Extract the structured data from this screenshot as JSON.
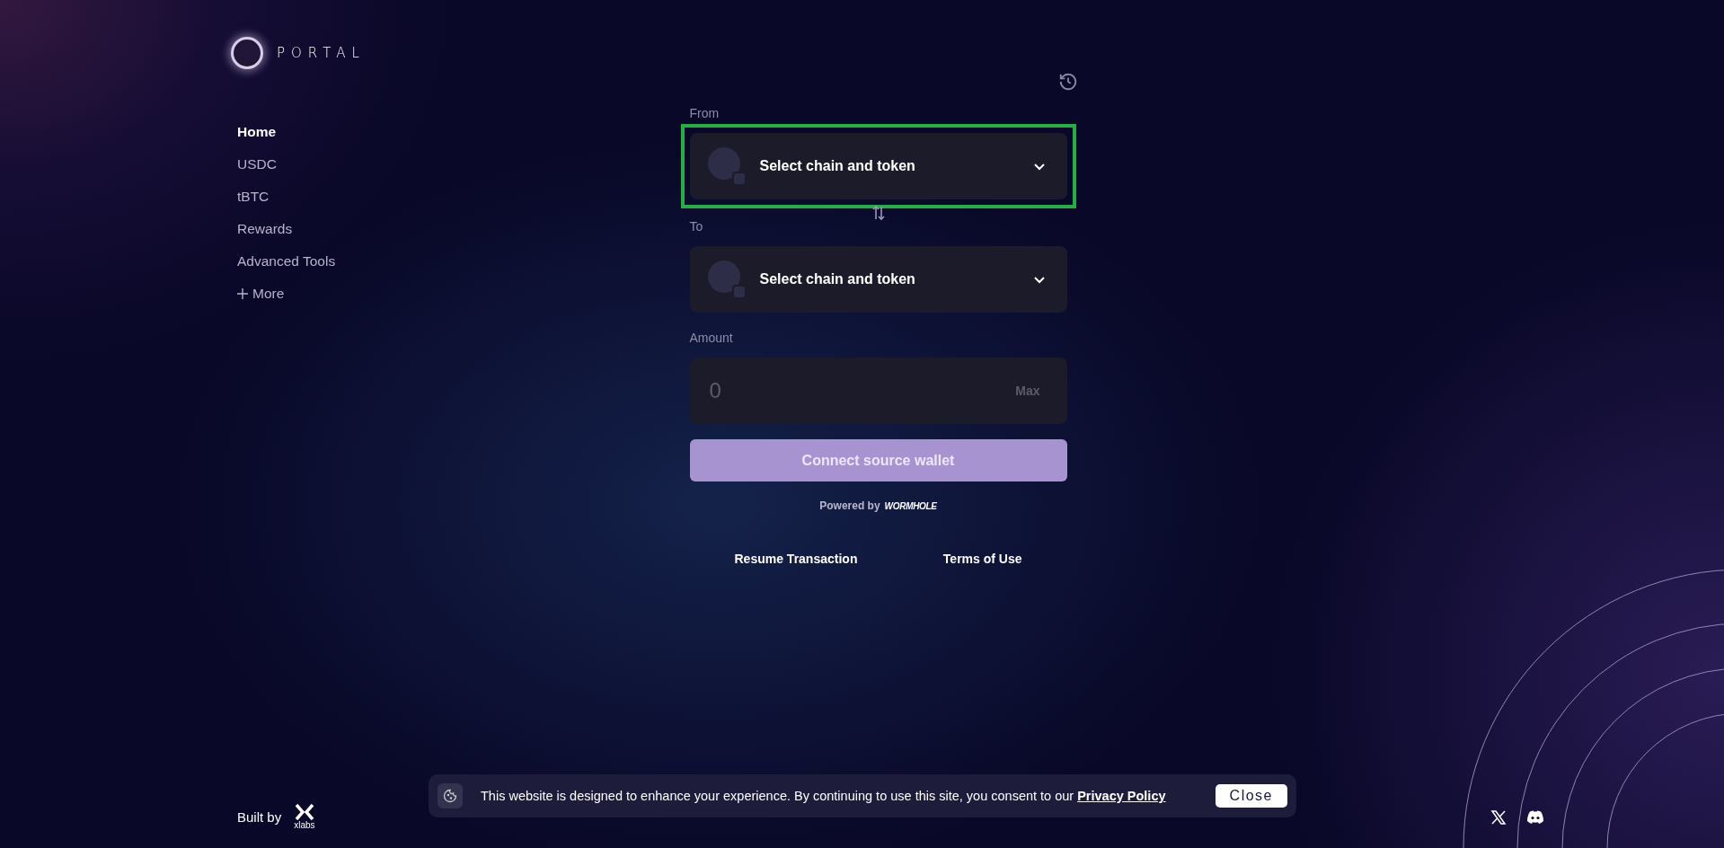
{
  "brand": {
    "name": "PORTAL"
  },
  "nav": [
    {
      "label": "Home",
      "selected": true
    },
    {
      "label": "USDC",
      "selected": false
    },
    {
      "label": "tBTC",
      "selected": false
    },
    {
      "label": "Rewards",
      "selected": false
    },
    {
      "label": "Advanced Tools",
      "selected": false
    },
    {
      "label": "More",
      "selected": false,
      "kind": "expander"
    }
  ],
  "bridge": {
    "from": {
      "label": "From",
      "placeholder": "Select chain and token",
      "focused": true
    },
    "to": {
      "label": "To",
      "placeholder": "Select chain and token"
    },
    "amount": {
      "label": "Amount",
      "placeholder": "0",
      "max": "Max"
    },
    "submit": {
      "label": "Connect source wallet",
      "disabled": true
    },
    "powered_by": {
      "text": "Powered by",
      "brand": "WORMHOLE"
    },
    "links": [
      "Resume Transaction",
      "Terms of Use"
    ]
  },
  "footer": {
    "built_by": "Built by",
    "builder": "xlabs"
  },
  "cookie_banner": {
    "text": "This website is designed to enhance your experience. By continuing to use this site, you consent to our",
    "link": "Privacy Policy",
    "button": "Close"
  }
}
